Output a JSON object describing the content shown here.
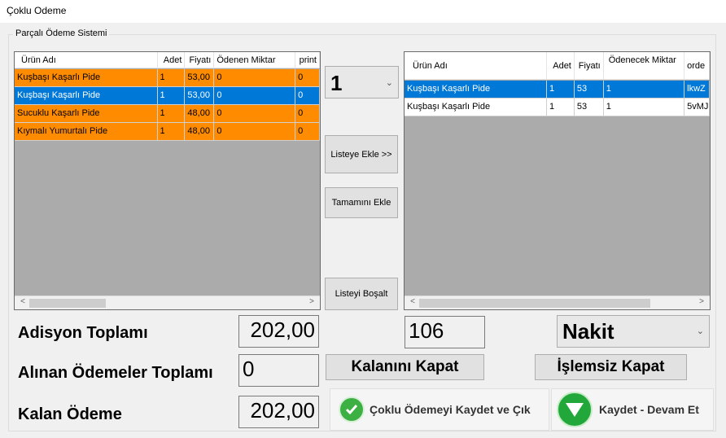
{
  "window": {
    "title": "Çoklu Odeme"
  },
  "group": {
    "title": "Parçalı Ödeme Sistemi"
  },
  "left_grid": {
    "columns": [
      "Ürün Adı",
      "Adet",
      "Fiyatı",
      "Ödenen Miktar",
      "print"
    ],
    "rows": [
      {
        "name": "Kuşbaşı Kaşarlı Pide",
        "qty": "1",
        "price": "53,00",
        "paid": "0",
        "print": "0",
        "state": "orange"
      },
      {
        "name": "Kuşbaşı Kaşarlı Pide",
        "qty": "1",
        "price": "53,00",
        "paid": "0",
        "print": "0",
        "state": "blue"
      },
      {
        "name": "Sucuklu Kaşarlı Pide",
        "qty": "1",
        "price": "48,00",
        "paid": "0",
        "print": "0",
        "state": "orange"
      },
      {
        "name": "Kıymalı Yumurtalı Pide",
        "qty": "1",
        "price": "48,00",
        "paid": "0",
        "print": "0",
        "state": "orange"
      }
    ]
  },
  "right_grid": {
    "columns": [
      "Ürün Adı",
      "Adet",
      "Fiyatı",
      "Ödenecek Miktar",
      "orde"
    ],
    "rows": [
      {
        "name": "Kuşbaşı Kaşarlı Pide",
        "qty": "1",
        "price": "53",
        "due": "1",
        "order": "lkwZ",
        "state": "blue"
      },
      {
        "name": "Kuşbaşı Kaşarlı Pide",
        "qty": "1",
        "price": "53",
        "due": "1",
        "order": "5vMJ",
        "state": "white"
      }
    ]
  },
  "qty_select": {
    "value": "1"
  },
  "buttons": {
    "add_to_list": "Listeye Ekle >>",
    "add_all": "Tamamını Ekle",
    "clear_list": "Listeyi Boşalt",
    "close_remaining": "Kalanını Kapat",
    "close_no_action": "İşlemsiz Kapat",
    "save_exit": "Çoklu Ödemeyi Kaydet ve Çık",
    "save_continue": "Kaydet - Devam Et"
  },
  "totals": {
    "bill_total_label": "Adisyon Toplamı",
    "bill_total": "202,00",
    "received_label": "Alınan Ödemeler Toplamı",
    "received": "0",
    "remaining_label": "Kalan Ödeme",
    "remaining": "202,00"
  },
  "selected_amount": "106",
  "payment_type": {
    "value": "Nakit"
  },
  "colors": {
    "orange_row": "#ff8c00",
    "selected_row": "#0078d7",
    "save_green": "#3cb043"
  }
}
